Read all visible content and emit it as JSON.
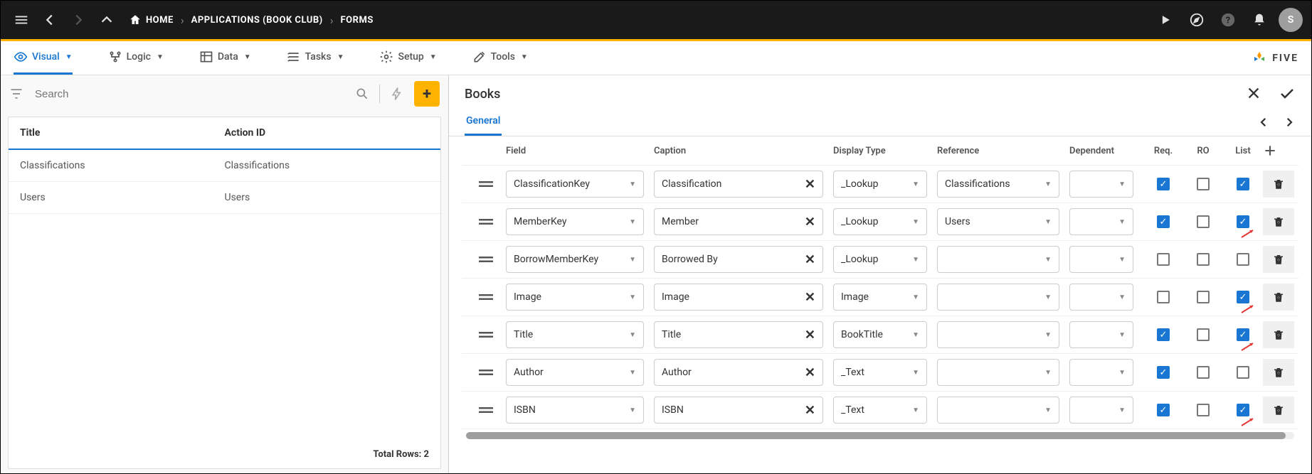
{
  "topbar": {
    "home": "HOME",
    "app": "APPLICATIONS (BOOK CLUB)",
    "section": "FORMS",
    "avatar": "S"
  },
  "menu": {
    "visual": "Visual",
    "logic": "Logic",
    "data": "Data",
    "tasks": "Tasks",
    "setup": "Setup",
    "tools": "Tools",
    "brand": "FIVE"
  },
  "search": {
    "placeholder": "Search"
  },
  "list": {
    "col1": "Title",
    "col2": "Action ID",
    "rows": [
      {
        "title": "Classifications",
        "action_id": "Classifications"
      },
      {
        "title": "Users",
        "action_id": "Users"
      }
    ],
    "footer": "Total Rows: 2"
  },
  "detail": {
    "title": "Books",
    "tab": "General",
    "columns": {
      "field": "Field",
      "caption": "Caption",
      "display_type": "Display Type",
      "reference": "Reference",
      "dependent": "Dependent",
      "req": "Req.",
      "ro": "RO",
      "list": "List"
    },
    "rows": [
      {
        "field": "ClassificationKey",
        "caption": "Classification",
        "display_type": "_Lookup",
        "reference": "Classifications",
        "dependent": "",
        "req": true,
        "ro": false,
        "list": true,
        "arrow": false
      },
      {
        "field": "MemberKey",
        "caption": "Member",
        "display_type": "_Lookup",
        "reference": "Users",
        "dependent": "",
        "req": true,
        "ro": false,
        "list": true,
        "arrow": true
      },
      {
        "field": "BorrowMemberKey",
        "caption": "Borrowed By",
        "display_type": "_Lookup",
        "reference": "",
        "dependent": "",
        "req": false,
        "ro": false,
        "list": false,
        "arrow": false
      },
      {
        "field": "Image",
        "caption": "Image",
        "display_type": "Image",
        "reference": "",
        "dependent": "",
        "req": false,
        "ro": false,
        "list": true,
        "arrow": true
      },
      {
        "field": "Title",
        "caption": "Title",
        "display_type": "BookTitle",
        "reference": "",
        "dependent": "",
        "req": true,
        "ro": false,
        "list": true,
        "arrow": true
      },
      {
        "field": "Author",
        "caption": "Author",
        "display_type": "_Text",
        "reference": "",
        "dependent": "",
        "req": true,
        "ro": false,
        "list": false,
        "arrow": false
      },
      {
        "field": "ISBN",
        "caption": "ISBN",
        "display_type": "_Text",
        "reference": "",
        "dependent": "",
        "req": true,
        "ro": false,
        "list": true,
        "arrow": true
      }
    ]
  }
}
